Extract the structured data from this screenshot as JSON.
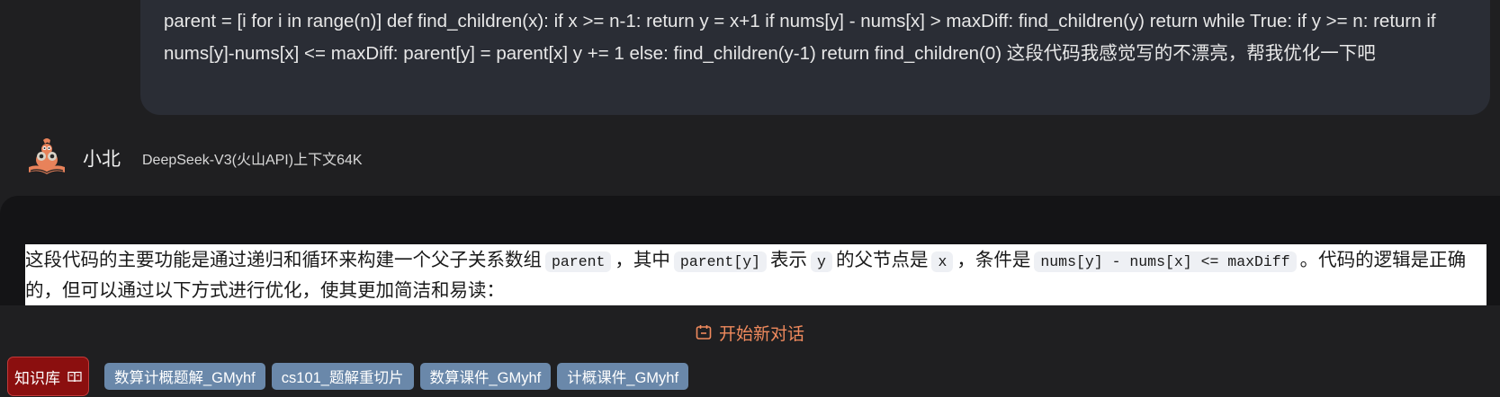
{
  "user_message": {
    "text": "parent = [i for i in range(n)] def find_children(x): if x >= n-1: return y = x+1 if nums[y] - nums[x] > maxDiff: find_children(y) return while True: if y >= n: return if nums[y]-nums[x] <= maxDiff: parent[y] = parent[x] y += 1 else: find_children(y-1) return find_children(0) 这段代码我感觉写的不漂亮，帮我优化一下吧"
  },
  "assistant": {
    "name": "小北",
    "model": "DeepSeek-V3(火山API)上下文64K",
    "avatar_icon": "cat-reading-book-icon"
  },
  "answer": {
    "segments": [
      "这段代码的主要功能是通过递归和循环来构建一个父子关系数组",
      "parent",
      "，其中",
      "parent[y]",
      "表示",
      "y",
      "的父节点是",
      "x",
      "，条件是",
      "nums[y] - nums[x] <= maxDiff",
      "。代码的逻辑是正确的，但可以通过以下方式进行优化，使其更加简洁和易读："
    ]
  },
  "new_chat": {
    "label": "开始新对话",
    "icon": "new-chat-icon"
  },
  "knowledge_base": {
    "label": "知识库",
    "icon": "book-icon"
  },
  "chips": [
    "数算计概题解_GMyhf",
    "cs101_题解重切片",
    "数算课件_GMyhf",
    "计概课件_GMyhf"
  ],
  "colors": {
    "background": "#1f1f21",
    "user_bubble": "#2a2d35",
    "answer_panel": "#141416",
    "accent_orange": "#f08a5d",
    "kb_button": "#8b0f0f",
    "chip": "#6a88aa"
  }
}
